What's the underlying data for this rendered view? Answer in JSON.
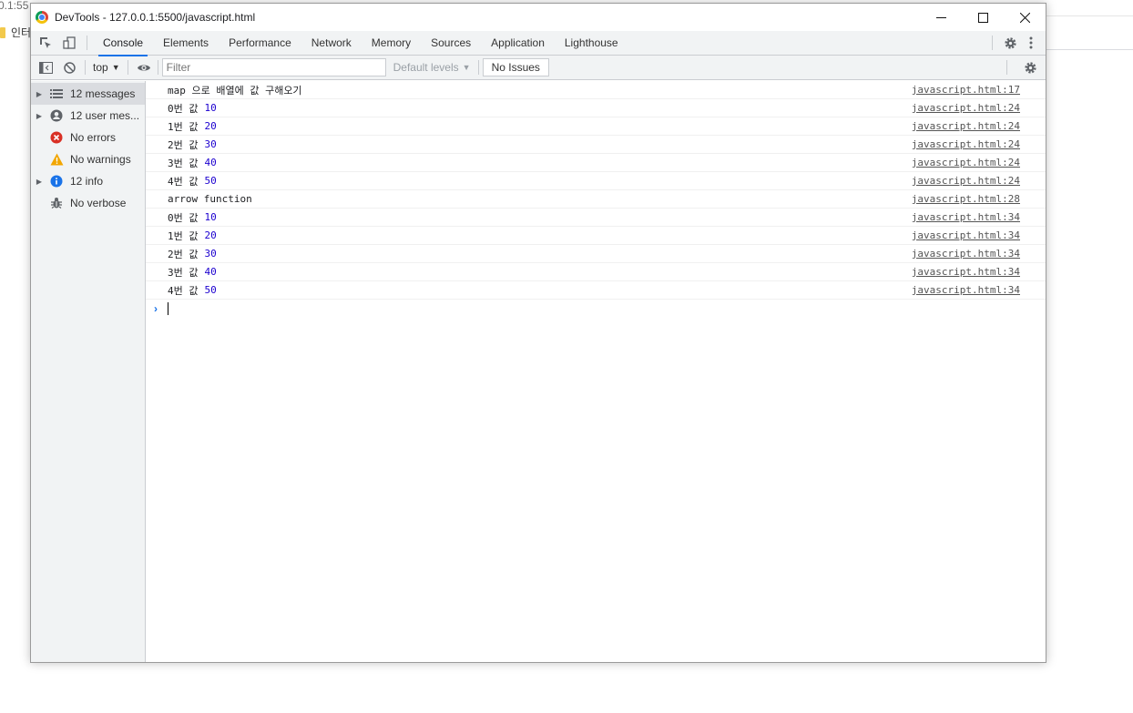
{
  "background": {
    "url_fragment": "0.1:55",
    "bookmark_label": "인터"
  },
  "window": {
    "title": "DevTools - 127.0.0.1:5500/javascript.html",
    "controls": {
      "minimize": "—",
      "maximize": "☐",
      "close": "✕"
    }
  },
  "tabs": [
    {
      "label": "Console",
      "active": true
    },
    {
      "label": "Elements"
    },
    {
      "label": "Performance"
    },
    {
      "label": "Network"
    },
    {
      "label": "Memory"
    },
    {
      "label": "Sources"
    },
    {
      "label": "Application"
    },
    {
      "label": "Lighthouse"
    }
  ],
  "toolbar": {
    "context": "top",
    "filter_placeholder": "Filter",
    "levels": "Default levels",
    "issues": "No Issues"
  },
  "sidebar": [
    {
      "label": "12 messages",
      "icon": "list-icon",
      "expandable": true,
      "selected": true
    },
    {
      "label": "12 user mes...",
      "icon": "user-icon",
      "expandable": true
    },
    {
      "label": "No errors",
      "icon": "error-icon",
      "expandable": false
    },
    {
      "label": "No warnings",
      "icon": "warning-icon",
      "expandable": false
    },
    {
      "label": "12 info",
      "icon": "info-icon",
      "expandable": true
    },
    {
      "label": "No verbose",
      "icon": "bug-icon",
      "expandable": false
    }
  ],
  "messages": [
    {
      "text": "map 으로 배열에 값 구해오기",
      "value": "",
      "source": "javascript.html:17"
    },
    {
      "text": "0번 값",
      "value": "10",
      "source": "javascript.html:24"
    },
    {
      "text": "1번 값",
      "value": "20",
      "source": "javascript.html:24"
    },
    {
      "text": "2번 값",
      "value": "30",
      "source": "javascript.html:24"
    },
    {
      "text": "3번 값",
      "value": "40",
      "source": "javascript.html:24"
    },
    {
      "text": "4번 값",
      "value": "50",
      "source": "javascript.html:24"
    },
    {
      "text": "arrow function",
      "value": "",
      "source": "javascript.html:28"
    },
    {
      "text": "0번 값",
      "value": "10",
      "source": "javascript.html:34"
    },
    {
      "text": "1번 값",
      "value": "20",
      "source": "javascript.html:34"
    },
    {
      "text": "2번 값",
      "value": "30",
      "source": "javascript.html:34"
    },
    {
      "text": "3번 값",
      "value": "40",
      "source": "javascript.html:34"
    },
    {
      "text": "4번 값",
      "value": "50",
      "source": "javascript.html:34"
    }
  ],
  "colors": {
    "accent": "#1a73e8",
    "number": "#1c00cf",
    "error": "#d93025",
    "warning": "#f2a600",
    "info": "#1a73e8"
  }
}
